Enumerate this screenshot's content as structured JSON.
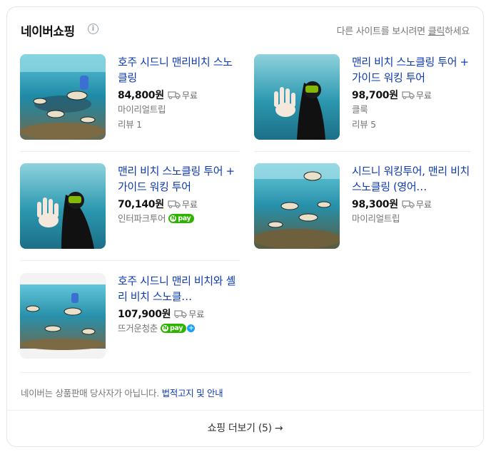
{
  "header": {
    "title": "네이버쇼핑",
    "info_icon": "i",
    "note_prefix": "다른 사이트를 보시려면 ",
    "note_link": "클릭",
    "note_suffix": "하세요"
  },
  "products": [
    {
      "title": "호주 시드니 맨리비치 스노클링",
      "price": "84,800원",
      "shipping": "무료",
      "seller": "마이리얼트립",
      "review": "리뷰 1",
      "npay": false
    },
    {
      "title": "맨리 비치 스노클링 투어 + 가이드 워킹 투어",
      "price": "98,700원",
      "shipping": "무료",
      "seller": "클룩",
      "review": "리뷰 5",
      "npay": false
    },
    {
      "title": "맨리 비치 스노클링 투어 + 가이드 워킹 투어",
      "price": "70,140원",
      "shipping": "무료",
      "seller": "인터파크투어",
      "review": "",
      "npay": true
    },
    {
      "title": "시드니 워킹투어, 맨리 비치 스노클링 (영어…",
      "price": "98,300원",
      "shipping": "무료",
      "seller": "마이리얼트립",
      "review": "",
      "npay": false
    },
    {
      "title": "호주 시드니 맨리 비치와 셸리 비치 스노클…",
      "price": "107,900원",
      "shipping": "무료",
      "seller": "뜨거운청춘",
      "review": "",
      "npay": true
    }
  ],
  "npay_label": "pay",
  "footer": {
    "disclaimer": "네이버는 상품판매 당사자가 아닙니다.",
    "link": "법적고지 및 안내",
    "more_label": "쇼핑 더보기 (5)",
    "more_arrow": "→"
  },
  "colors": {
    "link": "#0f3bb2",
    "npay_green": "#2db400",
    "plus_blue": "#18a0fb"
  }
}
